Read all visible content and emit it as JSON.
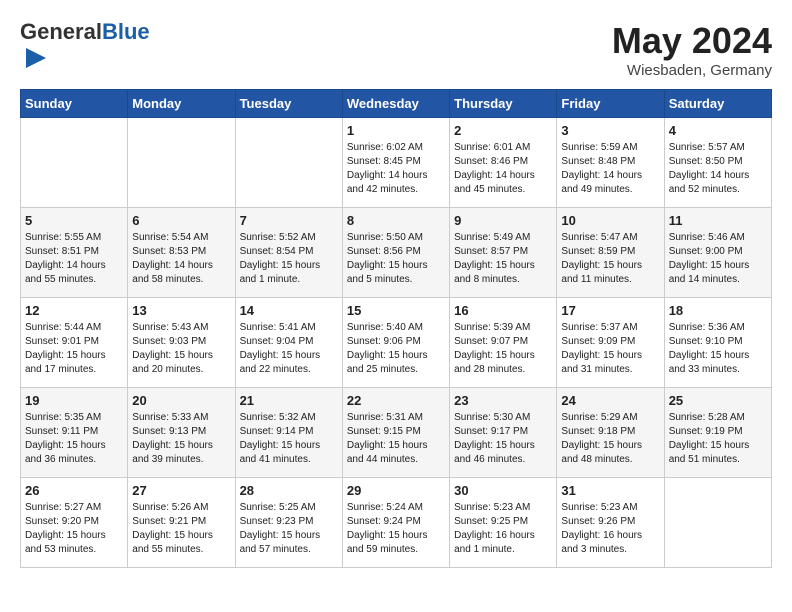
{
  "header": {
    "logo_general": "General",
    "logo_blue": "Blue",
    "month_year": "May 2024",
    "location": "Wiesbaden, Germany"
  },
  "weekdays": [
    "Sunday",
    "Monday",
    "Tuesday",
    "Wednesday",
    "Thursday",
    "Friday",
    "Saturday"
  ],
  "weeks": [
    [
      {
        "day": "",
        "sunrise": "",
        "sunset": "",
        "daylight": ""
      },
      {
        "day": "",
        "sunrise": "",
        "sunset": "",
        "daylight": ""
      },
      {
        "day": "",
        "sunrise": "",
        "sunset": "",
        "daylight": ""
      },
      {
        "day": "1",
        "sunrise": "Sunrise: 6:02 AM",
        "sunset": "Sunset: 8:45 PM",
        "daylight": "Daylight: 14 hours and 42 minutes."
      },
      {
        "day": "2",
        "sunrise": "Sunrise: 6:01 AM",
        "sunset": "Sunset: 8:46 PM",
        "daylight": "Daylight: 14 hours and 45 minutes."
      },
      {
        "day": "3",
        "sunrise": "Sunrise: 5:59 AM",
        "sunset": "Sunset: 8:48 PM",
        "daylight": "Daylight: 14 hours and 49 minutes."
      },
      {
        "day": "4",
        "sunrise": "Sunrise: 5:57 AM",
        "sunset": "Sunset: 8:50 PM",
        "daylight": "Daylight: 14 hours and 52 minutes."
      }
    ],
    [
      {
        "day": "5",
        "sunrise": "Sunrise: 5:55 AM",
        "sunset": "Sunset: 8:51 PM",
        "daylight": "Daylight: 14 hours and 55 minutes."
      },
      {
        "day": "6",
        "sunrise": "Sunrise: 5:54 AM",
        "sunset": "Sunset: 8:53 PM",
        "daylight": "Daylight: 14 hours and 58 minutes."
      },
      {
        "day": "7",
        "sunrise": "Sunrise: 5:52 AM",
        "sunset": "Sunset: 8:54 PM",
        "daylight": "Daylight: 15 hours and 1 minute."
      },
      {
        "day": "8",
        "sunrise": "Sunrise: 5:50 AM",
        "sunset": "Sunset: 8:56 PM",
        "daylight": "Daylight: 15 hours and 5 minutes."
      },
      {
        "day": "9",
        "sunrise": "Sunrise: 5:49 AM",
        "sunset": "Sunset: 8:57 PM",
        "daylight": "Daylight: 15 hours and 8 minutes."
      },
      {
        "day": "10",
        "sunrise": "Sunrise: 5:47 AM",
        "sunset": "Sunset: 8:59 PM",
        "daylight": "Daylight: 15 hours and 11 minutes."
      },
      {
        "day": "11",
        "sunrise": "Sunrise: 5:46 AM",
        "sunset": "Sunset: 9:00 PM",
        "daylight": "Daylight: 15 hours and 14 minutes."
      }
    ],
    [
      {
        "day": "12",
        "sunrise": "Sunrise: 5:44 AM",
        "sunset": "Sunset: 9:01 PM",
        "daylight": "Daylight: 15 hours and 17 minutes."
      },
      {
        "day": "13",
        "sunrise": "Sunrise: 5:43 AM",
        "sunset": "Sunset: 9:03 PM",
        "daylight": "Daylight: 15 hours and 20 minutes."
      },
      {
        "day": "14",
        "sunrise": "Sunrise: 5:41 AM",
        "sunset": "Sunset: 9:04 PM",
        "daylight": "Daylight: 15 hours and 22 minutes."
      },
      {
        "day": "15",
        "sunrise": "Sunrise: 5:40 AM",
        "sunset": "Sunset: 9:06 PM",
        "daylight": "Daylight: 15 hours and 25 minutes."
      },
      {
        "day": "16",
        "sunrise": "Sunrise: 5:39 AM",
        "sunset": "Sunset: 9:07 PM",
        "daylight": "Daylight: 15 hours and 28 minutes."
      },
      {
        "day": "17",
        "sunrise": "Sunrise: 5:37 AM",
        "sunset": "Sunset: 9:09 PM",
        "daylight": "Daylight: 15 hours and 31 minutes."
      },
      {
        "day": "18",
        "sunrise": "Sunrise: 5:36 AM",
        "sunset": "Sunset: 9:10 PM",
        "daylight": "Daylight: 15 hours and 33 minutes."
      }
    ],
    [
      {
        "day": "19",
        "sunrise": "Sunrise: 5:35 AM",
        "sunset": "Sunset: 9:11 PM",
        "daylight": "Daylight: 15 hours and 36 minutes."
      },
      {
        "day": "20",
        "sunrise": "Sunrise: 5:33 AM",
        "sunset": "Sunset: 9:13 PM",
        "daylight": "Daylight: 15 hours and 39 minutes."
      },
      {
        "day": "21",
        "sunrise": "Sunrise: 5:32 AM",
        "sunset": "Sunset: 9:14 PM",
        "daylight": "Daylight: 15 hours and 41 minutes."
      },
      {
        "day": "22",
        "sunrise": "Sunrise: 5:31 AM",
        "sunset": "Sunset: 9:15 PM",
        "daylight": "Daylight: 15 hours and 44 minutes."
      },
      {
        "day": "23",
        "sunrise": "Sunrise: 5:30 AM",
        "sunset": "Sunset: 9:17 PM",
        "daylight": "Daylight: 15 hours and 46 minutes."
      },
      {
        "day": "24",
        "sunrise": "Sunrise: 5:29 AM",
        "sunset": "Sunset: 9:18 PM",
        "daylight": "Daylight: 15 hours and 48 minutes."
      },
      {
        "day": "25",
        "sunrise": "Sunrise: 5:28 AM",
        "sunset": "Sunset: 9:19 PM",
        "daylight": "Daylight: 15 hours and 51 minutes."
      }
    ],
    [
      {
        "day": "26",
        "sunrise": "Sunrise: 5:27 AM",
        "sunset": "Sunset: 9:20 PM",
        "daylight": "Daylight: 15 hours and 53 minutes."
      },
      {
        "day": "27",
        "sunrise": "Sunrise: 5:26 AM",
        "sunset": "Sunset: 9:21 PM",
        "daylight": "Daylight: 15 hours and 55 minutes."
      },
      {
        "day": "28",
        "sunrise": "Sunrise: 5:25 AM",
        "sunset": "Sunset: 9:23 PM",
        "daylight": "Daylight: 15 hours and 57 minutes."
      },
      {
        "day": "29",
        "sunrise": "Sunrise: 5:24 AM",
        "sunset": "Sunset: 9:24 PM",
        "daylight": "Daylight: 15 hours and 59 minutes."
      },
      {
        "day": "30",
        "sunrise": "Sunrise: 5:23 AM",
        "sunset": "Sunset: 9:25 PM",
        "daylight": "Daylight: 16 hours and 1 minute."
      },
      {
        "day": "31",
        "sunrise": "Sunrise: 5:23 AM",
        "sunset": "Sunset: 9:26 PM",
        "daylight": "Daylight: 16 hours and 3 minutes."
      },
      {
        "day": "",
        "sunrise": "",
        "sunset": "",
        "daylight": ""
      }
    ]
  ]
}
